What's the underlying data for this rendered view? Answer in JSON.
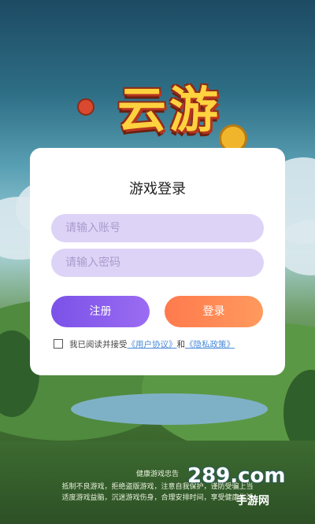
{
  "logo": {
    "text": "云游"
  },
  "login": {
    "title": "游戏登录",
    "account_placeholder": "请输入账号",
    "password_placeholder": "请输入密码",
    "register_label": "注册",
    "login_label": "登录",
    "agree_prefix": "我已阅读并接受",
    "user_agreement": "《用户协议》",
    "and": "和",
    "privacy_policy": "《隐私政策》"
  },
  "footer": {
    "title": "健康游戏忠告",
    "line1": "抵制不良游戏，拒绝盗版游戏，注意自我保护，谨防受骗上当",
    "line2": "适度游戏益脑，沉迷游戏伤身，合理安排时间，享受健康生活"
  },
  "watermark": {
    "main": "289.com",
    "sub": "手游网"
  },
  "colors": {
    "register": "#7b52e8",
    "login": "#ff7a4d",
    "input_bg": "#ddd3f7",
    "link": "#4a8bd8"
  }
}
